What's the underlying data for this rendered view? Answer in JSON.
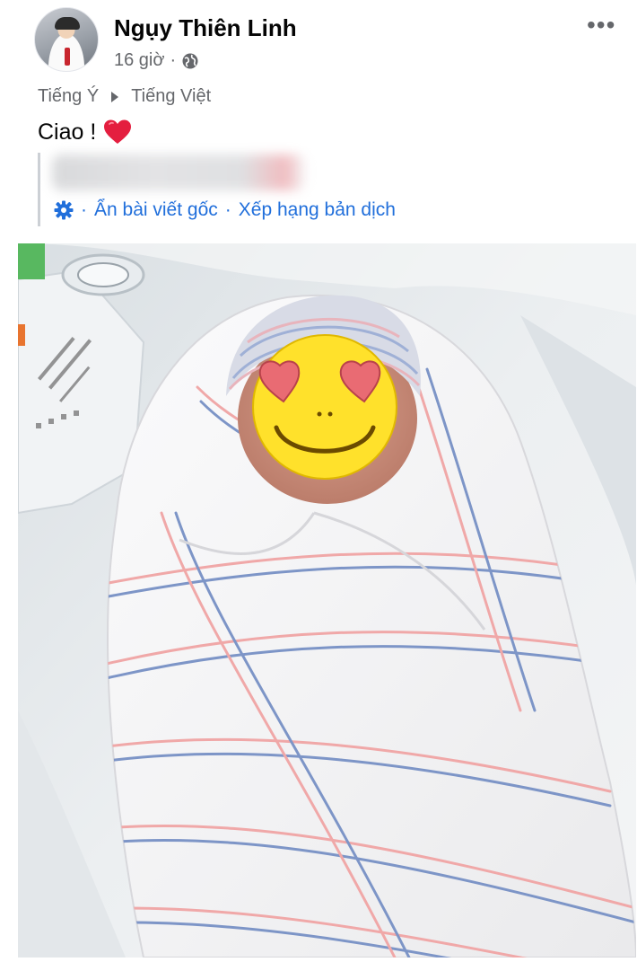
{
  "post": {
    "author_name": "Ngụy Thiên Linh",
    "time_ago": "16 giờ",
    "meta_separator": "·",
    "privacy_icon": "globe-icon",
    "more_icon": "more-options-icon",
    "more_glyph": "•••"
  },
  "translation": {
    "source_language": "Tiếng Ý",
    "target_language": "Tiếng Việt",
    "translated_text": "Ciao !",
    "hide_original_label": "Ẩn bài viết gốc",
    "rate_translation_label": "Xếp hạng bản dịch",
    "separator": "·"
  },
  "colors": {
    "text_primary": "#050505",
    "text_secondary": "#65676b",
    "link_blue": "#216fdb",
    "heart_red": "#e41e3f",
    "emoji_yellow": "#ffe12b"
  },
  "photo": {
    "subject": "newborn baby swaddled in striped hospital blanket",
    "face_cover": "heart-eyes-emoji"
  }
}
